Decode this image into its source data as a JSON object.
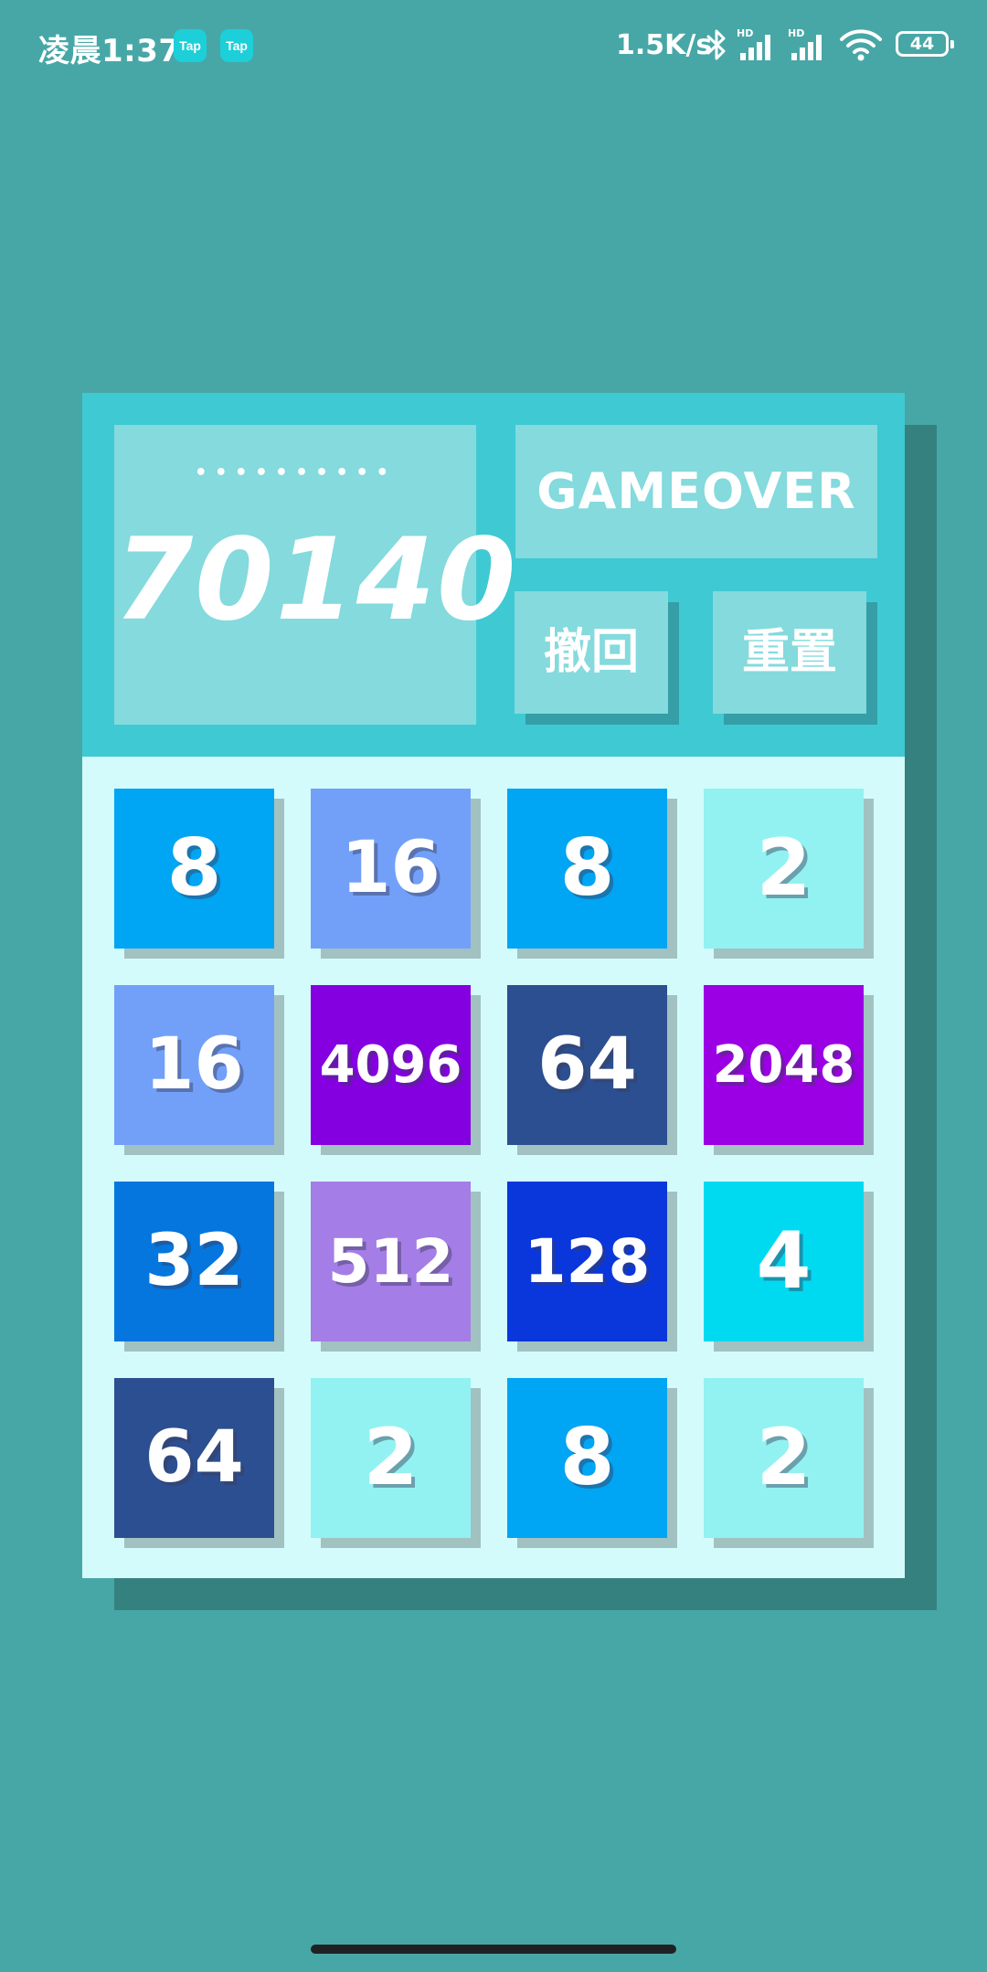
{
  "status_bar": {
    "time": "凌晨1:37",
    "notification_badges": [
      "Tap",
      "Tap"
    ],
    "network_speed": "1.5K/s",
    "battery_level": "44",
    "icons": [
      "bluetooth-icon",
      "signal-hd-icon",
      "signal-hd-icon",
      "wifi-icon",
      "battery-icon"
    ]
  },
  "game": {
    "score_dots": "••••••••••",
    "score": "70140",
    "status": "GAMEOVER",
    "undo_label": "撤回",
    "reset_label": "重置",
    "tiles": [
      [
        "8",
        "16",
        "8",
        "2"
      ],
      [
        "16",
        "4096",
        "64",
        "2048"
      ],
      [
        "32",
        "512",
        "128",
        "4"
      ],
      [
        "64",
        "2",
        "8",
        "2"
      ]
    ]
  },
  "colors": {
    "background": "#47a7a6",
    "header": "#3fc9d3",
    "panel": "#84dadd",
    "grid_background": "#d4fbfb",
    "tile_2": "#92f2f1",
    "tile_4": "#00daf1",
    "tile_8": "#00a5f3",
    "tile_16": "#72a0f9",
    "tile_32": "#0476de",
    "tile_64": "#2b4f90",
    "tile_128": "#0937dc",
    "tile_512": "#a47de6",
    "tile_2048": "#9b00e4",
    "tile_4096": "#8400e0"
  }
}
